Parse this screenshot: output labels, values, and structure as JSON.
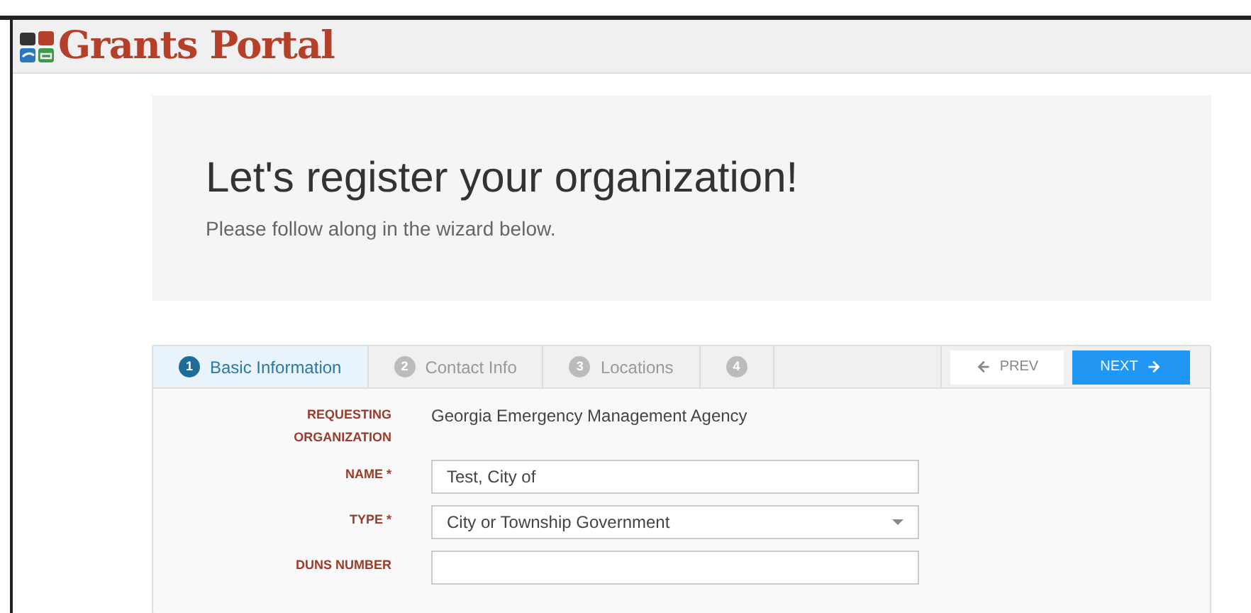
{
  "header": {
    "logo_text": "Grants Portal"
  },
  "hero": {
    "title": "Let's register your organization!",
    "subtitle": "Please follow along in the wizard below."
  },
  "wizard": {
    "steps": [
      {
        "number": "1",
        "label": "Basic Information",
        "selected": true
      },
      {
        "number": "2",
        "label": "Contact Info",
        "selected": false
      },
      {
        "number": "3",
        "label": "Locations",
        "selected": false
      },
      {
        "number": "4",
        "selected": false
      }
    ],
    "prev_button": "PREV",
    "next_button": "NEXT",
    "fields": [
      {
        "kind": "static",
        "label": "REQUESTING ORGANIZATION",
        "value": "Georgia Emergency Management Agency"
      },
      {
        "kind": "text",
        "label": "NAME *",
        "value": "Test, City of"
      },
      {
        "kind": "select",
        "label": "TYPE *",
        "value": "City or Township Government"
      },
      {
        "kind": "text",
        "label": "DUNS NUMBER"
      }
    ]
  }
}
